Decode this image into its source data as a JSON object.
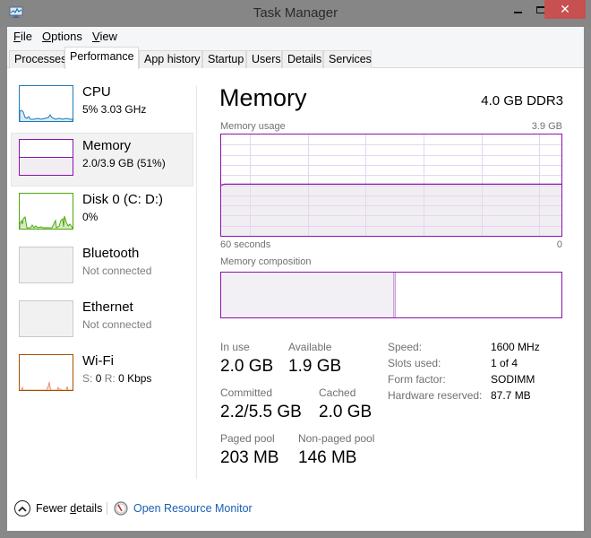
{
  "window": {
    "title": "Task Manager",
    "app_icon": "task-manager-icon",
    "controls": {
      "minimize": "minimize-icon",
      "maximize": "maximize-icon",
      "close": "close-icon",
      "close_glyph": "✕"
    }
  },
  "menu": {
    "items": [
      {
        "label": "File",
        "accel": "F",
        "rest": "ile"
      },
      {
        "label": "Options",
        "accel": "O",
        "rest": "ptions"
      },
      {
        "label": "View",
        "accel": "V",
        "rest": "iew"
      }
    ]
  },
  "tabs": [
    {
      "label": "Processes",
      "active": false
    },
    {
      "label": "Performance",
      "active": true
    },
    {
      "label": "App history",
      "active": false
    },
    {
      "label": "Startup",
      "active": false
    },
    {
      "label": "Users",
      "active": false
    },
    {
      "label": "Details",
      "active": false
    },
    {
      "label": "Services",
      "active": false
    }
  ],
  "sidebar": {
    "items": [
      {
        "name": "CPU",
        "sub": "5% 3.03 GHz",
        "color": "#1d7ab8",
        "selected": false
      },
      {
        "name": "Memory",
        "sub": "2.0/3.9 GB (51%)",
        "color": "#8b12ae",
        "selected": true,
        "usage_fraction": 0.51
      },
      {
        "name": "Disk 0 (C: D:)",
        "sub": "0%",
        "color": "#4da60c",
        "selected": false
      },
      {
        "name": "Bluetooth",
        "sub": "Not connected",
        "color": "#c9c9c9",
        "selected": false
      },
      {
        "name": "Ethernet",
        "sub": "Not connected",
        "color": "#c9c9c9",
        "selected": false
      },
      {
        "name": "Wi-Fi",
        "sub_send_label": "S:",
        "sub_send": "0",
        "sub_recv_label": "R:",
        "sub_recv": "0 Kbps",
        "color": "#a74f01",
        "selected": false
      }
    ]
  },
  "main": {
    "title": "Memory",
    "subtitle": "4.0 GB DDR3",
    "usage_graph": {
      "label": "Memory usage",
      "max_label": "3.9 GB",
      "time_left_label": "60 seconds",
      "time_right_label": "0",
      "usage_fraction": 0.51,
      "color": "#8b12ae"
    },
    "composition": {
      "label": "Memory composition",
      "in_use_fraction": 0.505,
      "modified_fraction": 0.008
    },
    "stats": {
      "in_use_label": "In use",
      "in_use": "2.0 GB",
      "available_label": "Available",
      "available": "1.9 GB",
      "committed_label": "Committed",
      "committed": "2.2/5.5 GB",
      "cached_label": "Cached",
      "cached": "2.0 GB",
      "paged_pool_label": "Paged pool",
      "paged_pool": "203 MB",
      "non_paged_pool_label": "Non-paged pool",
      "non_paged_pool": "146 MB"
    },
    "properties": [
      {
        "label": "Speed:",
        "value": "1600 MHz"
      },
      {
        "label": "Slots used:",
        "value": "1 of 4"
      },
      {
        "label": "Form factor:",
        "value": "SODIMM"
      },
      {
        "label": "Hardware reserved:",
        "value": "87.7 MB"
      }
    ]
  },
  "footer": {
    "fewer_details_pre": "Fewer ",
    "fewer_details_accel": "d",
    "fewer_details_post": "etails",
    "fewer_details_icon": "chevron-up-circle-icon",
    "resource_monitor": "Open Resource Monitor",
    "resource_monitor_icon": "resource-monitor-icon"
  }
}
